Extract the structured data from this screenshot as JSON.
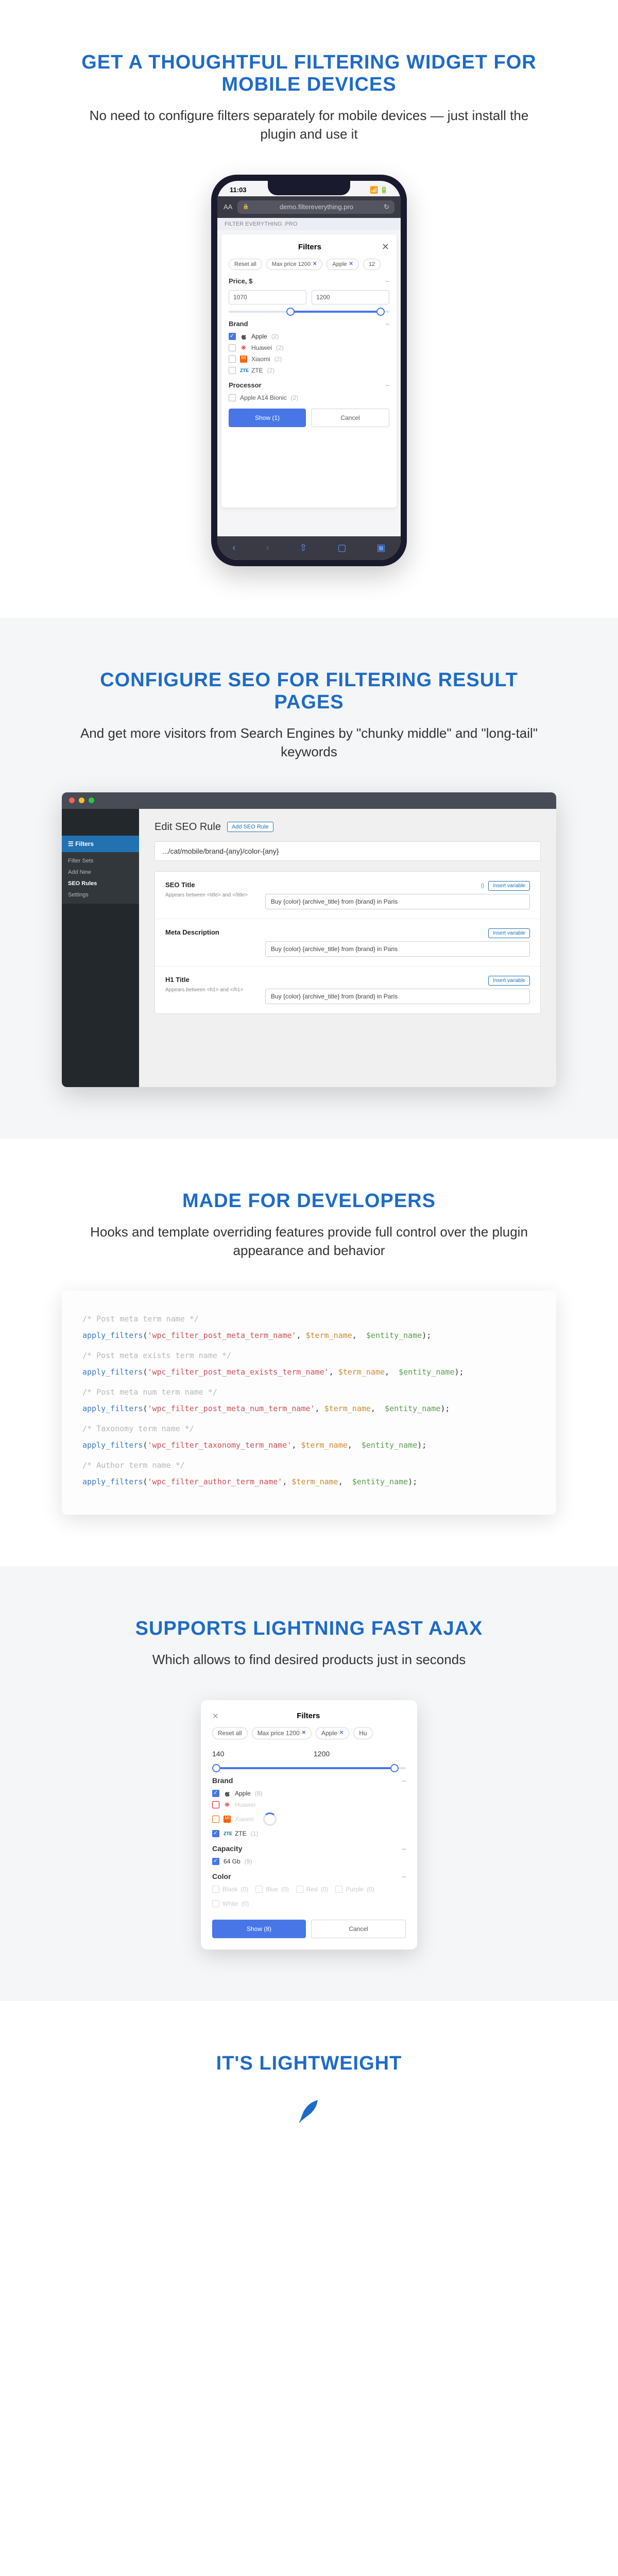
{
  "s1": {
    "heading": "GET A THOUGHTFUL FILTERING WIDGET FOR MOBILE DEVICES",
    "sub": "No need to configure filters separately for mobile devices — just install the plugin and use it",
    "phone": {
      "time": "11:03",
      "aa": "AA",
      "url": "demo.filtereverything.pro",
      "refresh": "↻",
      "banner": "FILTER EVERYTHING .PRO",
      "title": "Filters",
      "close": "✕",
      "chip_reset": "Reset all",
      "chip_price": "Max price 1200",
      "chip_apple": "Apple",
      "chip_128": "12",
      "price_label": "Price, $",
      "price_min": "1070",
      "price_max": "1200",
      "minus": "–",
      "brand_label": "Brand",
      "b_apple": "Apple",
      "b_apple_n": "(2)",
      "b_huawei": "Huawei",
      "b_huawei_n": "(2)",
      "b_xiaomi": "Xiaomi",
      "b_xiaomi_n": "(2)",
      "b_zte": "ZTE",
      "b_zte_n": "(2)",
      "proc_label": "Processor",
      "proc_1": "Apple A14 Bionic",
      "proc_1_n": "(2)",
      "show": "Show (1)",
      "cancel": "Cancel",
      "nav_back": "‹",
      "nav_fwd": "›",
      "nav_share": "⇧",
      "nav_book": "▢",
      "nav_tabs": "▣"
    }
  },
  "s2": {
    "heading": "CONFIGURE SEO FOR FILTERING RESULT PAGES",
    "sub": "And get more visitors from Search Engines by \"chunky middle\" and \"long-tail\" keywords",
    "wp": {
      "h1": "Edit SEO Rule",
      "add": "Add SEO Rule",
      "url": ".../cat/mobile/brand-{any}/color-{any}",
      "side_filters": "Filters",
      "side_sets": "Filter Sets",
      "side_new": "Add New",
      "side_seo": "SEO Rules",
      "side_settings": "Settings",
      "row1_t": "SEO Title",
      "row1_s": "Appears between\n<title> and </title>",
      "row2_t": "Meta Description",
      "row3_t": "H1 Title",
      "row3_s": "Appears between\n<h1> and </h1>",
      "hint_var": "{}",
      "insert": "Insert variable",
      "val": "Buy {color} {archive_title} from {brand} in Paris"
    }
  },
  "s3": {
    "heading": "MADE FOR DEVELOPERS",
    "sub": "Hooks and template overriding features provide full control over the plugin appearance and behavior",
    "code": {
      "c1": "/* Post meta term name */",
      "l1_a": "apply_filters",
      "l1_b": "'wpc_filter_post_meta_term_name'",
      "l1_c": "$term_name",
      "l1_d": "$entity_name",
      "c2": "/* Post meta exists term name */",
      "l2_b": "'wpc_filter_post_meta_exists_term_name'",
      "c3": "/* Post meta num term name */",
      "l3_b": "'wpc_filter_post_meta_num_term_name'",
      "c4": "/* Taxonomy term name */",
      "l4_b": "'wpc_filter_taxonomy_term_name'",
      "c5": "/* Author term name */",
      "l5_b": "'wpc_filter_author_term_name'"
    }
  },
  "s4": {
    "heading": "SUPPORTS LIGHTNING FAST AJAX",
    "sub": "Which allows to find desired products just in seconds",
    "ajax": {
      "title": "Filters",
      "close": "✕",
      "chip_reset": "Reset all",
      "chip_price": "Max price 1200",
      "chip_apple": "Apple",
      "chip_hu": "Hu",
      "p_min": "140",
      "p_max": "1200",
      "brand": "Brand",
      "minus": "–",
      "apple": "Apple",
      "apple_n": "(8)",
      "huawei": "Huawei",
      "xiaomi": "Xiaomi",
      "zte": "ZTE",
      "zte_n": "(1)",
      "capacity": "Capacity",
      "cap1": "64 Gb",
      "cap1_n": "(9)",
      "color": "Color",
      "c_black": "Black",
      "cn": "(0)",
      "c_blue": "Blue",
      "c_red": "Red",
      "c_purple": "Purple",
      "c_white": "White",
      "show": "Show (8)",
      "cancel": "Cancel"
    }
  },
  "s5": {
    "heading": "IT'S LIGHTWEIGHT"
  }
}
